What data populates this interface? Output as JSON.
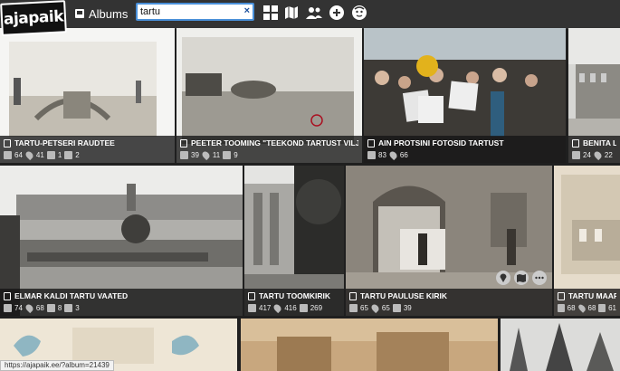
{
  "header": {
    "logo_text": "ajapaik",
    "albums_label": "Albums",
    "search_value": "tartu",
    "clear_symbol": "×"
  },
  "tiles": [
    {
      "title": "TARTU-PETSERI RAUDTEE",
      "photos": "64",
      "locations": "41",
      "albums": "1",
      "rephotos": "2"
    },
    {
      "title": "PEETER TOOMING \"TEEKOND TARTUST VILJAN…",
      "photos": "39",
      "locations": "11",
      "rephotos": "9"
    },
    {
      "title": "AIN PROTSINI FOTOSID TARTUST",
      "photos": "83",
      "locations": "66"
    },
    {
      "title": "BENITA LA…",
      "photos": "24",
      "locations": "22"
    },
    {
      "title": "ELMAR KALDI TARTU VAATED",
      "photos": "74",
      "locations": "68",
      "albums": "8",
      "rephotos": "3"
    },
    {
      "title": "TARTU TOOMKIRIK",
      "photos": "417",
      "locations": "416",
      "rephotos": "269"
    },
    {
      "title": "TARTU PAULUSE KIRIK",
      "photos": "65",
      "locations": "65",
      "rephotos": "39"
    },
    {
      "title": "TARTU MAARJA…",
      "photos": "68",
      "locations": "68",
      "rephotos": "61"
    }
  ],
  "status_url": "https://ajapaik.ee/?album=21439",
  "icons": {
    "albums": "album-icon",
    "grid": "grid-icon",
    "map": "map-icon",
    "users": "users-icon",
    "add": "plus-circle-icon",
    "profile": "avatar-icon"
  }
}
